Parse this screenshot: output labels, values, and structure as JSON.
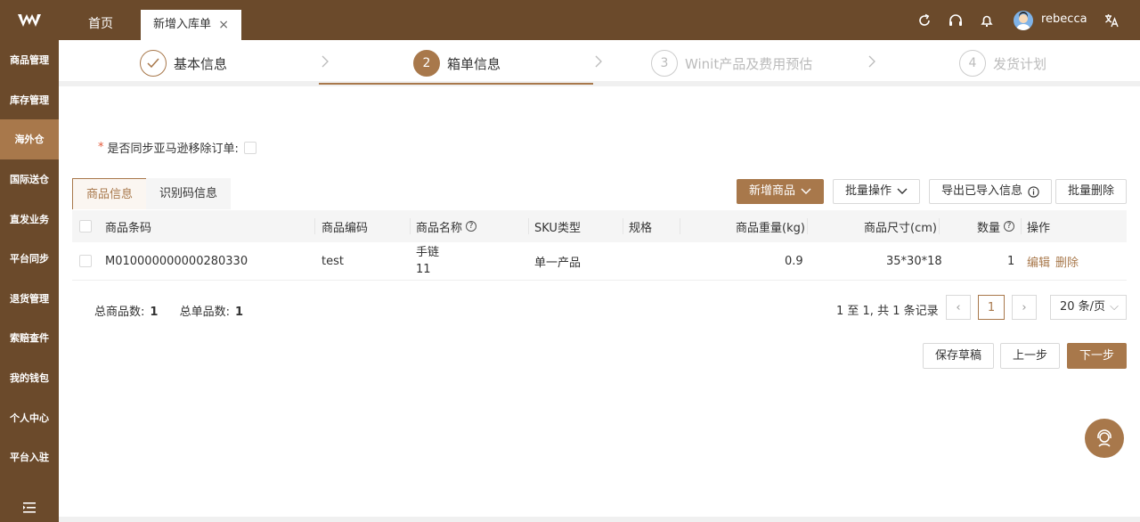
{
  "sidebar": {
    "items": [
      {
        "label": "商品管理"
      },
      {
        "label": "库存管理"
      },
      {
        "label": "海外仓"
      },
      {
        "label": "国际送仓"
      },
      {
        "label": "直发业务"
      },
      {
        "label": "平台同步"
      },
      {
        "label": "退货管理"
      },
      {
        "label": "索赔查件"
      },
      {
        "label": "我的钱包"
      },
      {
        "label": "个人中心"
      },
      {
        "label": "平台入驻"
      }
    ],
    "active_index": 2
  },
  "topbar": {
    "home_tab": "首页",
    "current_tab": "新增入库单",
    "close": "×",
    "username": "rebecca",
    "icons": [
      "refresh-icon",
      "headset-icon",
      "bell-icon",
      "translate-icon"
    ]
  },
  "steps": [
    {
      "num": "",
      "label": "基本信息",
      "state": "done"
    },
    {
      "num": "2",
      "label": "箱单信息",
      "state": "active"
    },
    {
      "num": "3",
      "label": "Winit产品及费用预估",
      "state": "pending"
    },
    {
      "num": "4",
      "label": "发货计划",
      "state": "pending"
    }
  ],
  "sync": {
    "required_mark": "*",
    "label": "是否同步亚马逊移除订单:"
  },
  "subtabs": {
    "product_info": "商品信息",
    "id_code_info": "识别码信息"
  },
  "toolbar": {
    "add_product": "新增商品",
    "batch_ops": "批量操作",
    "export_imported": "导出已导入信息",
    "batch_delete": "批量删除"
  },
  "table": {
    "headers": {
      "barcode": "商品条码",
      "code": "商品编码",
      "name": "商品名称",
      "sku_type": "SKU类型",
      "spec": "规格",
      "weight": "商品重量(kg)",
      "size": "商品尺寸(cm)",
      "qty": "数量",
      "ops": "操作"
    },
    "rows": [
      {
        "barcode": "M010000000000280330",
        "code": "test",
        "name_line1": "手链",
        "name_line2": "11",
        "sku_type": "单一产品",
        "spec": "",
        "weight": "0.9",
        "size": "35*30*18",
        "qty": "1",
        "edit": "编辑",
        "delete": "删除"
      }
    ]
  },
  "summary": {
    "total_products_label": "总商品数:",
    "total_products": "1",
    "total_single_label": "总单品数:",
    "total_single": "1"
  },
  "pagination": {
    "range_text": "1 至 1, 共 1 条记录",
    "prev": "‹",
    "current_page": "1",
    "next": "›",
    "page_size": "20 条/页"
  },
  "actions": {
    "save_draft": "保存草稿",
    "prev_step": "上一步",
    "next_step": "下一步"
  },
  "colors": {
    "brand_dark": "#6b4a2b",
    "accent": "#a8784b"
  }
}
